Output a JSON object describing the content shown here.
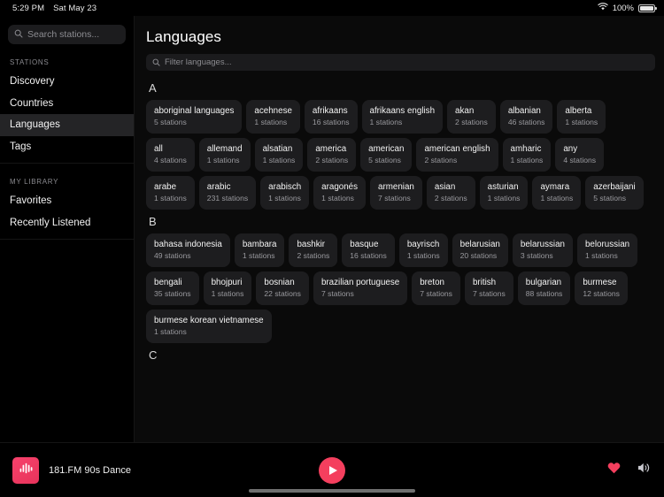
{
  "statusbar": {
    "time": "5:29 PM",
    "date": "Sat May 23",
    "battery": "100%",
    "wifi_icon": "wifi-icon",
    "battery_icon": "battery-icon"
  },
  "sidebar": {
    "search": {
      "placeholder": "Search stations...",
      "value": "",
      "icon": "search-icon"
    },
    "sections": [
      {
        "label": "STATIONS",
        "items": [
          {
            "label": "Discovery",
            "active": false
          },
          {
            "label": "Countries",
            "active": false
          },
          {
            "label": "Languages",
            "active": true
          },
          {
            "label": "Tags",
            "active": false
          }
        ]
      },
      {
        "label": "MY LIBRARY",
        "items": [
          {
            "label": "Favorites",
            "active": false
          },
          {
            "label": "Recently Listened",
            "active": false
          }
        ]
      }
    ]
  },
  "main": {
    "title": "Languages",
    "filter": {
      "placeholder": "Filter languages...",
      "value": "",
      "icon": "search-icon"
    },
    "groups": [
      {
        "letter": "A",
        "items": [
          {
            "name": "aboriginal languages",
            "count": "5 stations"
          },
          {
            "name": "acehnese",
            "count": "1 stations"
          },
          {
            "name": "afrikaans",
            "count": "16 stations"
          },
          {
            "name": "afrikaans english",
            "count": "1 stations"
          },
          {
            "name": "akan",
            "count": "2 stations"
          },
          {
            "name": "albanian",
            "count": "46 stations"
          },
          {
            "name": "alberta",
            "count": "1 stations"
          },
          {
            "name": "all",
            "count": "4 stations"
          },
          {
            "name": "allemand",
            "count": "1 stations"
          },
          {
            "name": "alsatian",
            "count": "1 stations"
          },
          {
            "name": "america",
            "count": "2 stations"
          },
          {
            "name": "american",
            "count": "5 stations"
          },
          {
            "name": "american english",
            "count": "2 stations"
          },
          {
            "name": "amharic",
            "count": "1 stations"
          },
          {
            "name": "any",
            "count": "4 stations"
          },
          {
            "name": "arabe",
            "count": "1 stations"
          },
          {
            "name": "arabic",
            "count": "231 stations"
          },
          {
            "name": "arabisch",
            "count": "1 stations"
          },
          {
            "name": "aragonés",
            "count": "1 stations"
          },
          {
            "name": "armenian",
            "count": "7 stations"
          },
          {
            "name": "asian",
            "count": "2 stations"
          },
          {
            "name": "asturian",
            "count": "1 stations"
          },
          {
            "name": "aymara",
            "count": "1 stations"
          },
          {
            "name": "azerbaijani",
            "count": "5 stations"
          }
        ]
      },
      {
        "letter": "B",
        "items": [
          {
            "name": "bahasa indonesia",
            "count": "49 stations"
          },
          {
            "name": "bambara",
            "count": "1 stations"
          },
          {
            "name": "bashkir",
            "count": "2 stations"
          },
          {
            "name": "basque",
            "count": "16 stations"
          },
          {
            "name": "bayrisch",
            "count": "1 stations"
          },
          {
            "name": "belarusian",
            "count": "20 stations"
          },
          {
            "name": "belarussian",
            "count": "3 stations"
          },
          {
            "name": "belorussian",
            "count": "1 stations"
          },
          {
            "name": "bengali",
            "count": "35 stations"
          },
          {
            "name": "bhojpuri",
            "count": "1 stations"
          },
          {
            "name": "bosnian",
            "count": "22 stations"
          },
          {
            "name": "brazilian portuguese",
            "count": "7 stations"
          },
          {
            "name": "breton",
            "count": "7 stations"
          },
          {
            "name": "british",
            "count": "7 stations"
          },
          {
            "name": "bulgarian",
            "count": "88 stations"
          },
          {
            "name": "burmese",
            "count": "12 stations"
          },
          {
            "name": "burmese korean vietnamese",
            "count": "1 stations"
          }
        ]
      },
      {
        "letter": "C",
        "items": []
      }
    ]
  },
  "player": {
    "station_title": "181.FM 90s Dance",
    "artwork_icon": "waveform-icon",
    "play_icon": "play-icon",
    "favorite_icon": "heart-icon",
    "volume_icon": "speaker-icon"
  },
  "colors": {
    "accent": "#f43f5e",
    "card_bg": "#1d1d1f",
    "sidebar_active": "#242426"
  }
}
